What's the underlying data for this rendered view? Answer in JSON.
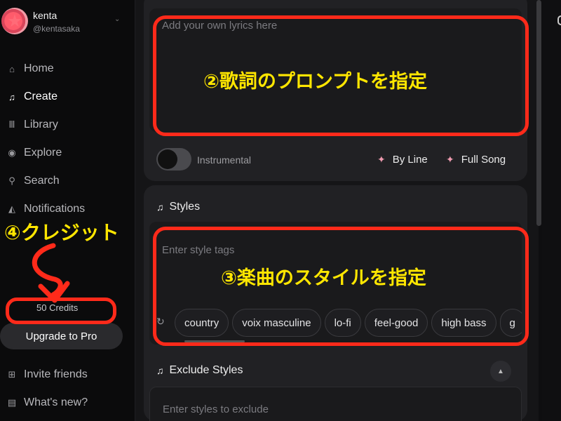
{
  "user": {
    "name": "kenta",
    "handle": "@kentasaka"
  },
  "nav": {
    "items": [
      {
        "label": "Home",
        "icon": "home-icon",
        "glyph": "⌂"
      },
      {
        "label": "Create",
        "icon": "create-music-icon",
        "glyph": "♫"
      },
      {
        "label": "Library",
        "icon": "library-icon",
        "glyph": "Ⅲ"
      },
      {
        "label": "Explore",
        "icon": "compass-icon",
        "glyph": "◉"
      },
      {
        "label": "Search",
        "icon": "search-icon",
        "glyph": "⚲"
      },
      {
        "label": "Notifications",
        "icon": "bell-icon",
        "glyph": "🔔︎"
      }
    ],
    "active": "Create",
    "bottom_items": [
      {
        "label": "Invite friends",
        "icon": "gift-icon",
        "glyph": "⊞"
      },
      {
        "label": "What's new?",
        "icon": "news-icon",
        "glyph": "▤"
      }
    ]
  },
  "credits": {
    "label": "50 Credits"
  },
  "upgrade": {
    "label": "Upgrade to Pro"
  },
  "lyrics": {
    "placeholder": "Add your own lyrics here"
  },
  "controls": {
    "instrumental_label": "Instrumental",
    "by_line_label": "By Line",
    "full_song_label": "Full Song"
  },
  "styles": {
    "header": "Styles",
    "placeholder": "Enter style tags",
    "chips": [
      "country",
      "voix masculine",
      "lo-fi",
      "feel-good",
      "high bass",
      "g"
    ]
  },
  "exclude": {
    "header": "Exclude Styles",
    "placeholder": "Enter styles to exclude"
  },
  "annotations": {
    "lyrics_note": "②歌詞のプロンプトを指定",
    "styles_note": "③楽曲のスタイルを指定",
    "credits_note": "④クレジット"
  },
  "colors": {
    "annotation_red": "#ff2a1a",
    "annotation_yellow": "#ffe600",
    "sparkle_pink": "#f09bb0"
  }
}
